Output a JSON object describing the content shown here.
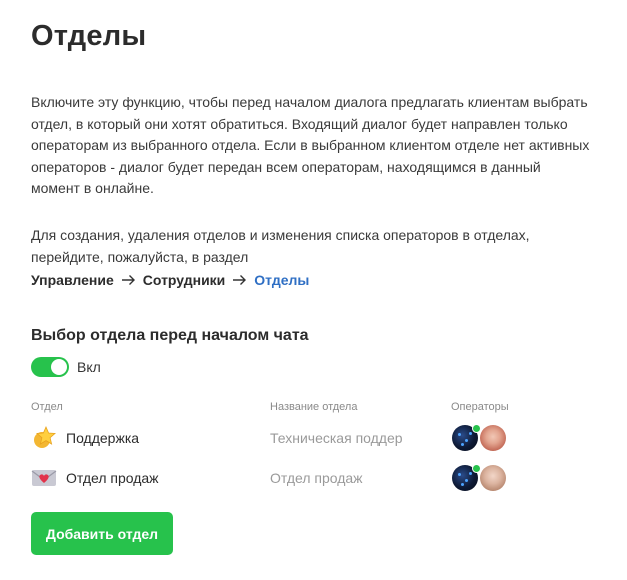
{
  "page": {
    "title": "Отделы",
    "description": "Включите эту функцию, чтобы перед началом диалога предлагать клиентам выбрать отдел, в который они хотят обратиться. Входящий диалог будет направлен только операторам из выбранного отдела. Если в выбранном клиентом отделе нет активных операторов - диалог будет передан всем операторам, находящимся в данный момент в онлайне.",
    "management_note": "Для создания, удаления отделов и изменения списка операторов в отделах, перейдите, пожалуйста, в раздел"
  },
  "breadcrumb": {
    "items": [
      {
        "label": "Управление"
      },
      {
        "label": "Сотрудники"
      },
      {
        "label": "Отделы"
      }
    ]
  },
  "selection": {
    "title": "Выбор отдела перед началом чата",
    "toggle_state": "on",
    "toggle_label": "Вкл"
  },
  "table": {
    "headers": {
      "department": "Отдел",
      "department_title": "Название отдела",
      "operators": "Операторы"
    },
    "rows": [
      {
        "name": "Поддержка",
        "title": "Техническая поддер",
        "icon": "star-badge-icon",
        "operators": [
          "operator-avatar-dark-online",
          "operator-avatar-woman"
        ]
      },
      {
        "name": "Отдел продаж",
        "title": "Отдел продаж",
        "icon": "envelope-heart-icon",
        "operators": [
          "operator-avatar-dark-online",
          "operator-avatar-man"
        ]
      }
    ]
  },
  "actions": {
    "add_department": "Добавить отдел"
  },
  "colors": {
    "accent_green": "#27c24c",
    "link_blue": "#2f6fc4"
  }
}
